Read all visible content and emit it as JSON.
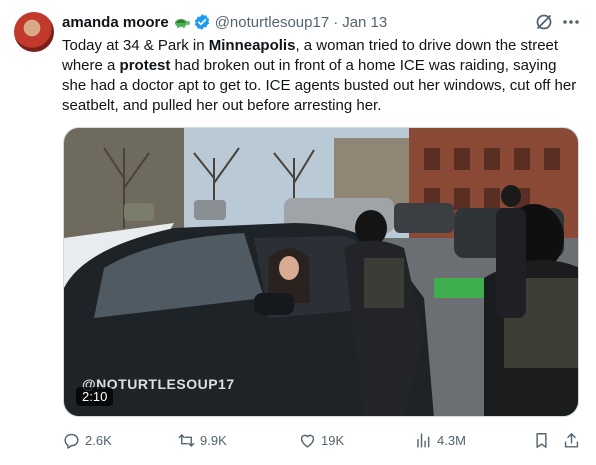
{
  "author": {
    "display_name": "amanda moore",
    "handle": "@noturtlesoup17",
    "date": "Jan 13"
  },
  "tweet": {
    "p1": "Today at 34 & Park in ",
    "b1": "Minneapolis",
    "p2": ", a woman tried to drive down the street where a ",
    "b2": "protest",
    "p3": " had broken out in front of a home ICE was raiding, saying she had a doctor apt to get to. ICE agents busted out her windows, cut off her seatbelt, and pulled her out before arresting her."
  },
  "media": {
    "duration": "2:10",
    "watermark": "@NOTURTLESOUP17"
  },
  "actions": {
    "replies": "2.6K",
    "reposts": "9.9K",
    "likes": "19K",
    "views": "4.3M"
  },
  "colors": {
    "text": "#0f1419",
    "secondary": "#536471",
    "verified": "#1d9bf0"
  },
  "icons": [
    "turtle-icon",
    "verified-icon",
    "grok-icon",
    "more-icon",
    "reply-icon",
    "retweet-icon",
    "like-icon",
    "views-icon",
    "bookmark-icon",
    "share-icon"
  ]
}
